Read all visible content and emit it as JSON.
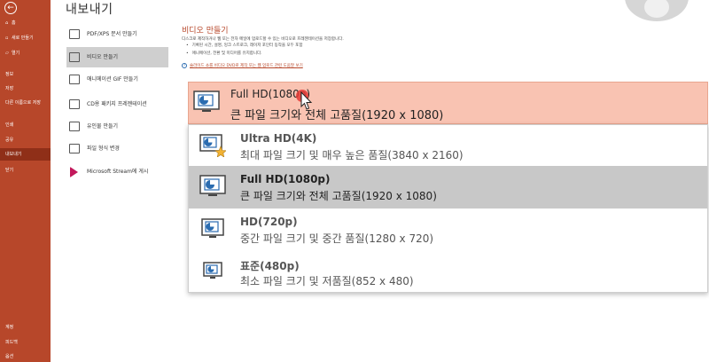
{
  "nav": {
    "back_glyph": "←",
    "items": [
      {
        "label": "홈",
        "icon": "⌂"
      },
      {
        "label": "새로 만들기",
        "icon": "▫"
      },
      {
        "label": "열기",
        "icon": "▱"
      },
      {
        "label": "정보",
        "icon": ""
      },
      {
        "label": "저장",
        "icon": ""
      },
      {
        "label": "다른 이름으로 저장",
        "icon": ""
      },
      {
        "label": "인쇄",
        "icon": ""
      },
      {
        "label": "공유",
        "icon": ""
      },
      {
        "label": "내보내기",
        "icon": ""
      },
      {
        "label": "닫기",
        "icon": ""
      },
      {
        "label": "계정",
        "icon": ""
      },
      {
        "label": "피드백",
        "icon": ""
      },
      {
        "label": "옵션",
        "icon": ""
      }
    ]
  },
  "page_title": "내보내기",
  "export_options": [
    {
      "label": "PDF/XPS 문서 만들기"
    },
    {
      "label": "비디오 만들기"
    },
    {
      "label": "애니메이션 GIF 만들기"
    },
    {
      "label": "CD용 패키지 프레젠테이션"
    },
    {
      "label": "유인물 만들기"
    },
    {
      "label": "파일 형식 변경"
    },
    {
      "label": "Microsoft Stream에 게시"
    }
  ],
  "detail": {
    "title": "비디오 만들기",
    "description": "디스크로 제작하거나 웹 또는 전자 메일에 업로드할 수 있는 비디오로 프레젠테이션을 저장합니다.",
    "bullets": [
      "기록된 시간, 설명, 잉크 스트로크, 레이저 포인터 동작을 모두 포함",
      "애니메이션, 전환 및 미디어를 유지합니다."
    ],
    "help_link": "슬라이드 쇼를 비디오 DVD로 제작 또는 웹 업로드 관련 도움말 보기"
  },
  "quality_dropdown": {
    "selected": {
      "title": "Full HD(1080p)",
      "desc": "큰 파일 크기와 전체 고품질(1920 x 1080)"
    },
    "options": [
      {
        "title": "Ultra HD(4K)",
        "desc": "최대 파일 크기 및 매우 높은 품질(3840 x 2160)"
      },
      {
        "title": "Full HD(1080p)",
        "desc": "큰 파일 크기와 전체 고품질(1920 x 1080)"
      },
      {
        "title": "HD(720p)",
        "desc": "중간 파일 크기 및 중간 품질(1280 x 720)"
      },
      {
        "title": "표준(480p)",
        "desc": "최소 파일 크기 및 저품질(852 x 480)"
      }
    ]
  },
  "colors": {
    "accent": "#b7472a",
    "selected_bg": "#f9c3b2",
    "highlight_bg": "#c8c8c8"
  }
}
